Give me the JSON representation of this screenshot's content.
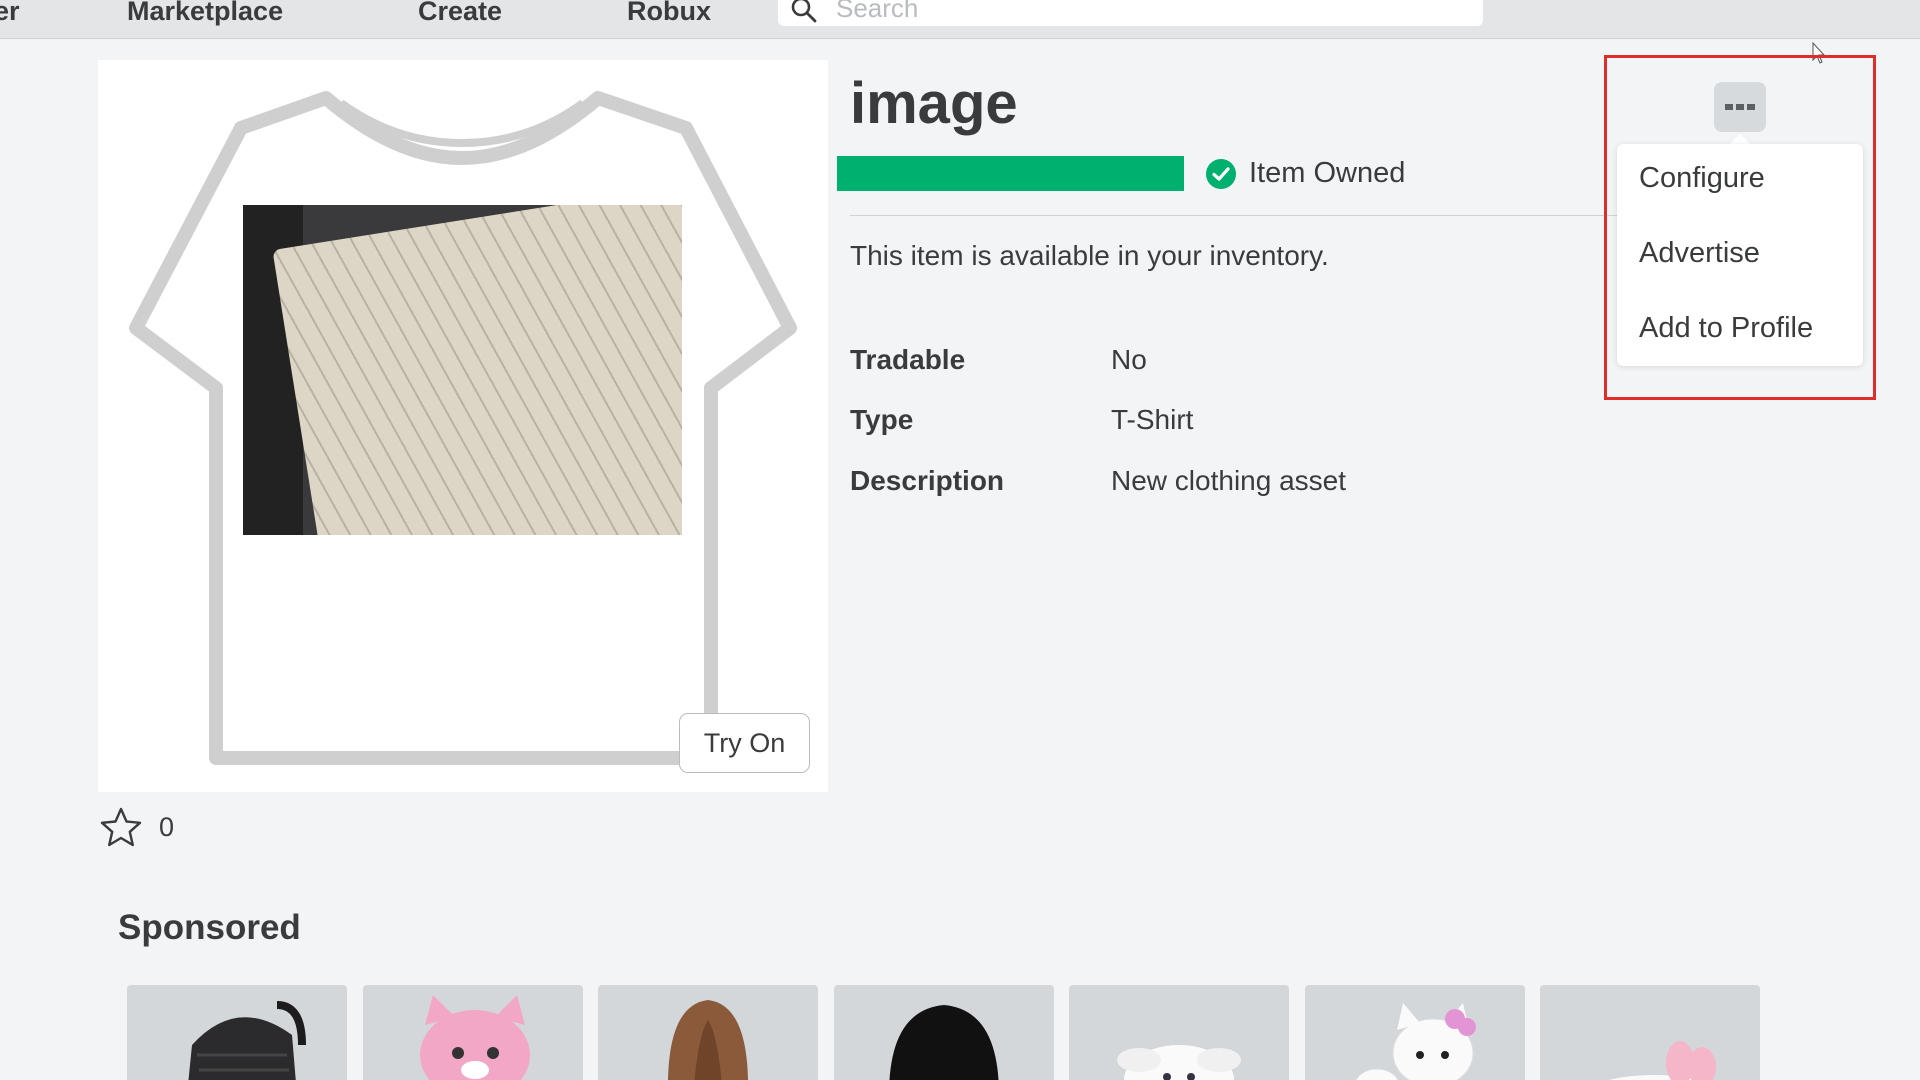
{
  "nav": {
    "partial_item": "er",
    "items": [
      "Marketplace",
      "Create",
      "Robux"
    ],
    "search_placeholder": "Search"
  },
  "item": {
    "title": "image",
    "status": "Item Owned",
    "availability": "This item is available in your inventory.",
    "try_on_label": "Try On",
    "favorites_count": "0",
    "details": [
      {
        "label": "Tradable",
        "value": "No"
      },
      {
        "label": "Type",
        "value": "T-Shirt"
      },
      {
        "label": "Description",
        "value": "New clothing asset"
      }
    ]
  },
  "menu": {
    "items": [
      "Configure",
      "Advertise",
      "Add to Profile"
    ]
  },
  "sponsored": {
    "heading": "Sponsored",
    "cards": [
      "backpack-item",
      "pink-cat-item",
      "brown-hair-item",
      "black-hair-item",
      "white-bunny-item",
      "kitty-item",
      "pink-bow-item"
    ]
  },
  "colors": {
    "owned_green": "#00b06f",
    "highlight_red": "#e12c2c",
    "background": "#f2f4f5"
  }
}
